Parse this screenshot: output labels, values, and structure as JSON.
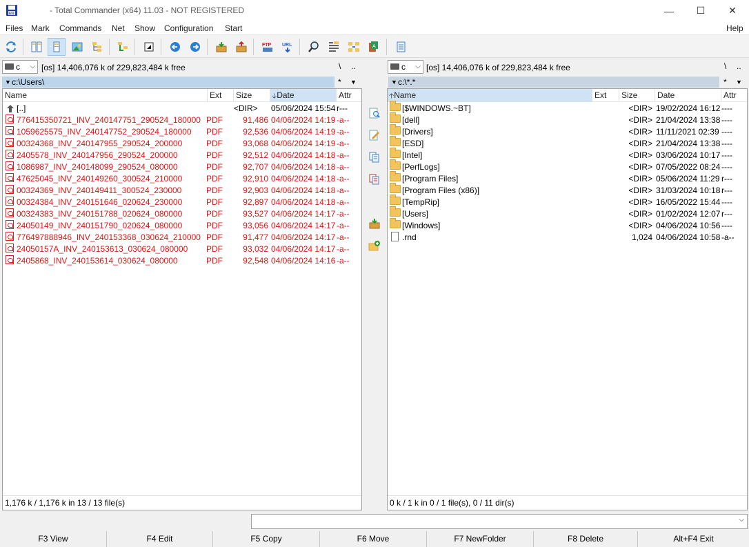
{
  "window": {
    "title": "- Total Commander (x64) 11.03 - NOT REGISTERED",
    "minimize": "—",
    "maximize": "☐",
    "close": "✕"
  },
  "menu": [
    "Files",
    "Mark",
    "Commands",
    "Net",
    "Show",
    "Configuration",
    "Start",
    "Help"
  ],
  "toolbar": {
    "icons": [
      "refresh-icon",
      "brief-view-icon",
      "full-view-icon",
      "thumbnails-icon",
      "tree-icon",
      "compare-icon",
      "invert-selection-icon",
      "back-icon",
      "forward-icon",
      "pack-icon",
      "unpack-icon",
      "ftp-icon",
      "url-icon",
      "search-icon",
      "multi-rename-icon",
      "sync-dirs-icon",
      "edit-icon",
      "notepad-icon"
    ]
  },
  "left": {
    "drive": "c",
    "drive_info": "[os]  14,406,076 k of 229,823,484 k free",
    "root_symbol": "\\",
    "up_symbol": "..",
    "path": "c:\\Users\\",
    "path_star": "*",
    "path_menu": "▼",
    "columns": {
      "name": "Name",
      "ext": "Ext",
      "size": "Size",
      "date": "Date",
      "attr": "Attr"
    },
    "sort_arrow": "🡣",
    "parent": {
      "name": "[..]",
      "size": "<DIR>",
      "date": "05/06/2024 15:54",
      "attr": "r---"
    },
    "files": [
      {
        "name": "776415350721_INV_240147751_290524_180000",
        "ext": "PDF",
        "size": "91,486",
        "date": "04/06/2024 14:19",
        "attr": "-a--"
      },
      {
        "name": "1059625575_INV_240147752_290524_180000",
        "ext": "PDF",
        "size": "92,536",
        "date": "04/06/2024 14:19",
        "attr": "-a--"
      },
      {
        "name": "00324368_INV_240147955_290524_200000",
        "ext": "PDF",
        "size": "93,068",
        "date": "04/06/2024 14:19",
        "attr": "-a--"
      },
      {
        "name": "2405578_INV_240147956_290524_200000",
        "ext": "PDF",
        "size": "92,512",
        "date": "04/06/2024 14:18",
        "attr": "-a--"
      },
      {
        "name": "1086987_INV_240148099_290524_080000",
        "ext": "PDF",
        "size": "92,707",
        "date": "04/06/2024 14:18",
        "attr": "-a--"
      },
      {
        "name": "47625045_INV_240149260_300524_210000",
        "ext": "PDF",
        "size": "92,910",
        "date": "04/06/2024 14:18",
        "attr": "-a--"
      },
      {
        "name": "00324369_INV_240149411_300524_230000",
        "ext": "PDF",
        "size": "92,903",
        "date": "04/06/2024 14:18",
        "attr": "-a--"
      },
      {
        "name": "00324384_INV_240151646_020624_230000",
        "ext": "PDF",
        "size": "92,897",
        "date": "04/06/2024 14:18",
        "attr": "-a--"
      },
      {
        "name": "00324383_INV_240151788_020624_080000",
        "ext": "PDF",
        "size": "93,527",
        "date": "04/06/2024 14:17",
        "attr": "-a--"
      },
      {
        "name": "24050149_INV_240151790_020624_080000",
        "ext": "PDF",
        "size": "93,056",
        "date": "04/06/2024 14:17",
        "attr": "-a--"
      },
      {
        "name": "776497888946_INV_240153368_030624_210000",
        "ext": "PDF",
        "size": "91,477",
        "date": "04/06/2024 14:17",
        "attr": "-a--"
      },
      {
        "name": "24050157A_INV_240153613_030624_080000",
        "ext": "PDF",
        "size": "93,032",
        "date": "04/06/2024 14:17",
        "attr": "-a--"
      },
      {
        "name": "2405868_INV_240153614_030624_080000",
        "ext": "PDF",
        "size": "92,548",
        "date": "04/06/2024 14:16",
        "attr": "-a--"
      }
    ],
    "status": "1,176 k / 1,176 k in 13 / 13 file(s)"
  },
  "right": {
    "drive": "c",
    "drive_info": "[os]  14,406,076 k of 229,823,484 k free",
    "root_symbol": "\\",
    "up_symbol": "..",
    "path": "c:\\*.*",
    "path_star": "*",
    "path_menu": "▼",
    "columns": {
      "name": "Name",
      "ext": "Ext",
      "size": "Size",
      "date": "Date",
      "attr": "Attr"
    },
    "sort_arrow": "🡡",
    "files": [
      {
        "name": "[$WINDOWS.~BT]",
        "size": "<DIR>",
        "date": "19/02/2024 16:12",
        "attr": "----",
        "type": "folder"
      },
      {
        "name": "[dell]",
        "size": "<DIR>",
        "date": "21/04/2024 13:38",
        "attr": "----",
        "type": "folder"
      },
      {
        "name": "[Drivers]",
        "size": "<DIR>",
        "date": "11/11/2021 02:39",
        "attr": "----",
        "type": "folder"
      },
      {
        "name": "[ESD]",
        "size": "<DIR>",
        "date": "21/04/2024 13:38",
        "attr": "----",
        "type": "folder"
      },
      {
        "name": "[Intel]",
        "size": "<DIR>",
        "date": "03/06/2024 10:17",
        "attr": "----",
        "type": "folder"
      },
      {
        "name": "[PerfLogs]",
        "size": "<DIR>",
        "date": "07/05/2022 08:24",
        "attr": "----",
        "type": "folder"
      },
      {
        "name": "[Program Files]",
        "size": "<DIR>",
        "date": "05/06/2024 11:29",
        "attr": "r---",
        "type": "folder"
      },
      {
        "name": "[Program Files (x86)]",
        "size": "<DIR>",
        "date": "31/03/2024 10:18",
        "attr": "r---",
        "type": "folder"
      },
      {
        "name": "[TempRip]",
        "size": "<DIR>",
        "date": "16/05/2022 15:44",
        "attr": "----",
        "type": "folder"
      },
      {
        "name": "[Users]",
        "size": "<DIR>",
        "date": "01/02/2024 12:07",
        "attr": "r---",
        "type": "folder"
      },
      {
        "name": "[Windows]",
        "size": "<DIR>",
        "date": "04/06/2024 10:56",
        "attr": "----",
        "type": "folder"
      },
      {
        "name": ".rnd",
        "size": "1,024",
        "date": "04/06/2024 10:58",
        "attr": "-a--",
        "type": "file"
      }
    ],
    "status": "0 k / 1 k in 0 / 1 file(s), 0 / 11 dir(s)"
  },
  "function_keys": [
    "F3 View",
    "F4 Edit",
    "F5 Copy",
    "F6 Move",
    "F7 NewFolder",
    "F8 Delete",
    "Alt+F4 Exit"
  ],
  "colors": {
    "selected_file": "#e01515",
    "active_path": "#bcd5ea",
    "sorted_column": "#cfe3f5"
  }
}
